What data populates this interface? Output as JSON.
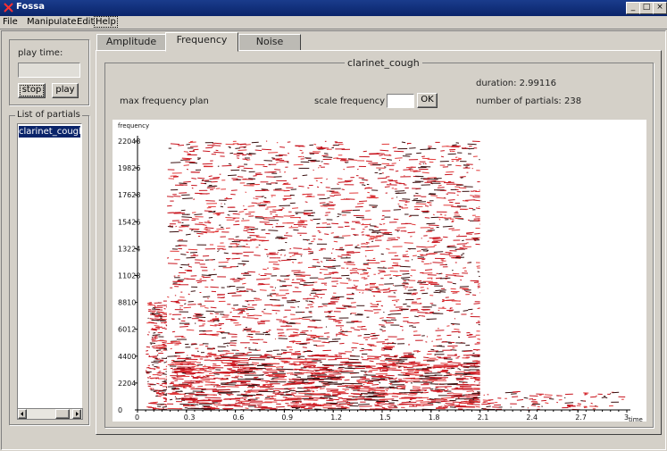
{
  "window": {
    "title": "Fossa",
    "minimize": "_",
    "maximize": "□",
    "close": "×"
  },
  "menu": [
    "File",
    "Manipulate",
    "Edit",
    "Help"
  ],
  "left_panel": {
    "playtime_label": "play time:",
    "playtime_value": "",
    "stop_label": "stop",
    "play_label": "play",
    "partials_label": "List of partials",
    "partials": [
      "clarinet_cough"
    ]
  },
  "tabs": [
    {
      "label": "Amplitude",
      "active": false
    },
    {
      "label": "Frequency",
      "active": true
    },
    {
      "label": "Noise",
      "active": false
    }
  ],
  "frequency_panel": {
    "group_title": "clarinet_cough",
    "duration": "duration: 2.99116",
    "num_partials": "number of partials: 238",
    "max_freq_label": "max frequency plan",
    "scale_label": "scale frequency",
    "scale_value": "",
    "ok_label": "OK"
  },
  "chart_data": {
    "type": "scatter",
    "description": "partials frequency vs time",
    "ylabel": "frequency",
    "xlabel": "time",
    "xlim": [
      0,
      3.0
    ],
    "ylim": [
      0,
      22048
    ],
    "y_ticks": [
      "0",
      "2204",
      "4400",
      "6012",
      "8810",
      "11028",
      "13224",
      "15426",
      "17628",
      "19826",
      "22048"
    ],
    "x_ticks": [
      "0",
      "0.3",
      "0.6",
      "0.9",
      "1.2",
      "1.5",
      "1.8",
      "2.1",
      "2.4",
      "2.7",
      "3"
    ],
    "dense_region": {
      "t_start": 0.18,
      "t_end": 2.1,
      "f_max": 22048
    },
    "onset_region": {
      "t_start": 0.05,
      "t_end": 0.18,
      "f_max": 9000
    },
    "tail_region": {
      "t_start": 2.1,
      "t_end": 2.99,
      "f_max": 1500
    },
    "colors": {
      "partial_a": "#c8141e",
      "partial_b": "#3a1010",
      "partial_c": "#e23a3a"
    }
  }
}
